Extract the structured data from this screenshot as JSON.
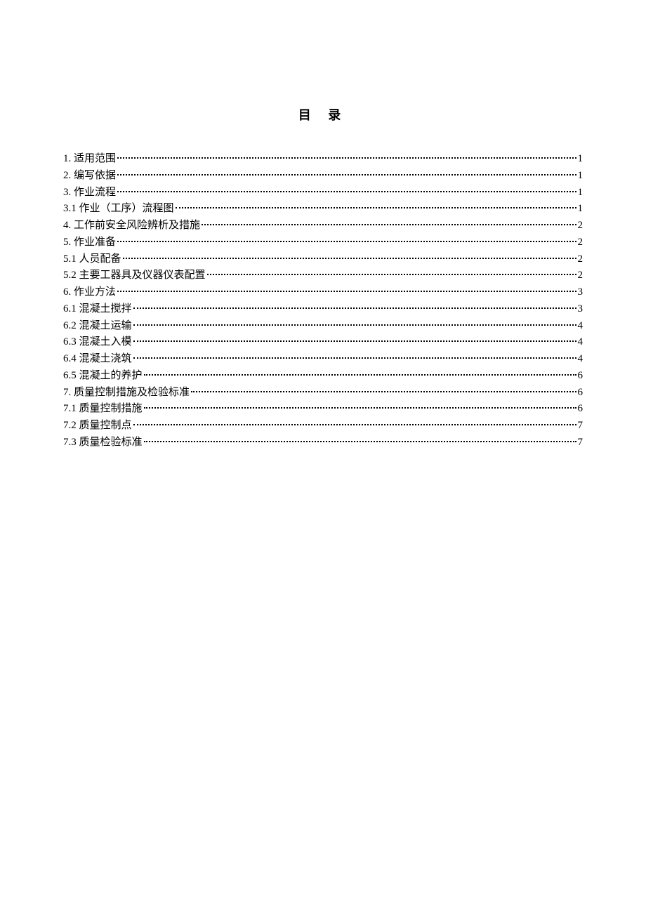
{
  "title": "目 录",
  "toc": [
    {
      "label": "1. 适用范围",
      "page": "1"
    },
    {
      "label": "2. 编写依据",
      "page": "1"
    },
    {
      "label": "3. 作业流程",
      "page": "1"
    },
    {
      "label": "3.1 作业（工序）流程图",
      "page": "1"
    },
    {
      "label": "4. 工作前安全风险辨析及措施",
      "page": "2"
    },
    {
      "label": "5. 作业准备",
      "page": "2"
    },
    {
      "label": "5.1 人员配备",
      "page": "2"
    },
    {
      "label": "5.2 主要工器具及仪器仪表配置",
      "page": "2"
    },
    {
      "label": "6. 作业方法",
      "page": "3"
    },
    {
      "label": "6.1 混凝土搅拌",
      "page": "3"
    },
    {
      "label": "6.2 混凝土运输",
      "page": "4"
    },
    {
      "label": "6.3 混凝土入模",
      "page": "4"
    },
    {
      "label": "6.4 混凝土浇筑",
      "page": "4"
    },
    {
      "label": "6.5 混凝土的养护",
      "page": "6"
    },
    {
      "label": "7. 质量控制措施及检验标准",
      "page": "6"
    },
    {
      "label": "7.1 质量控制措施",
      "page": "6"
    },
    {
      "label": "7.2 质量控制点",
      "page": "7"
    },
    {
      "label": "7.3 质量检验标准",
      "page": "7"
    }
  ]
}
